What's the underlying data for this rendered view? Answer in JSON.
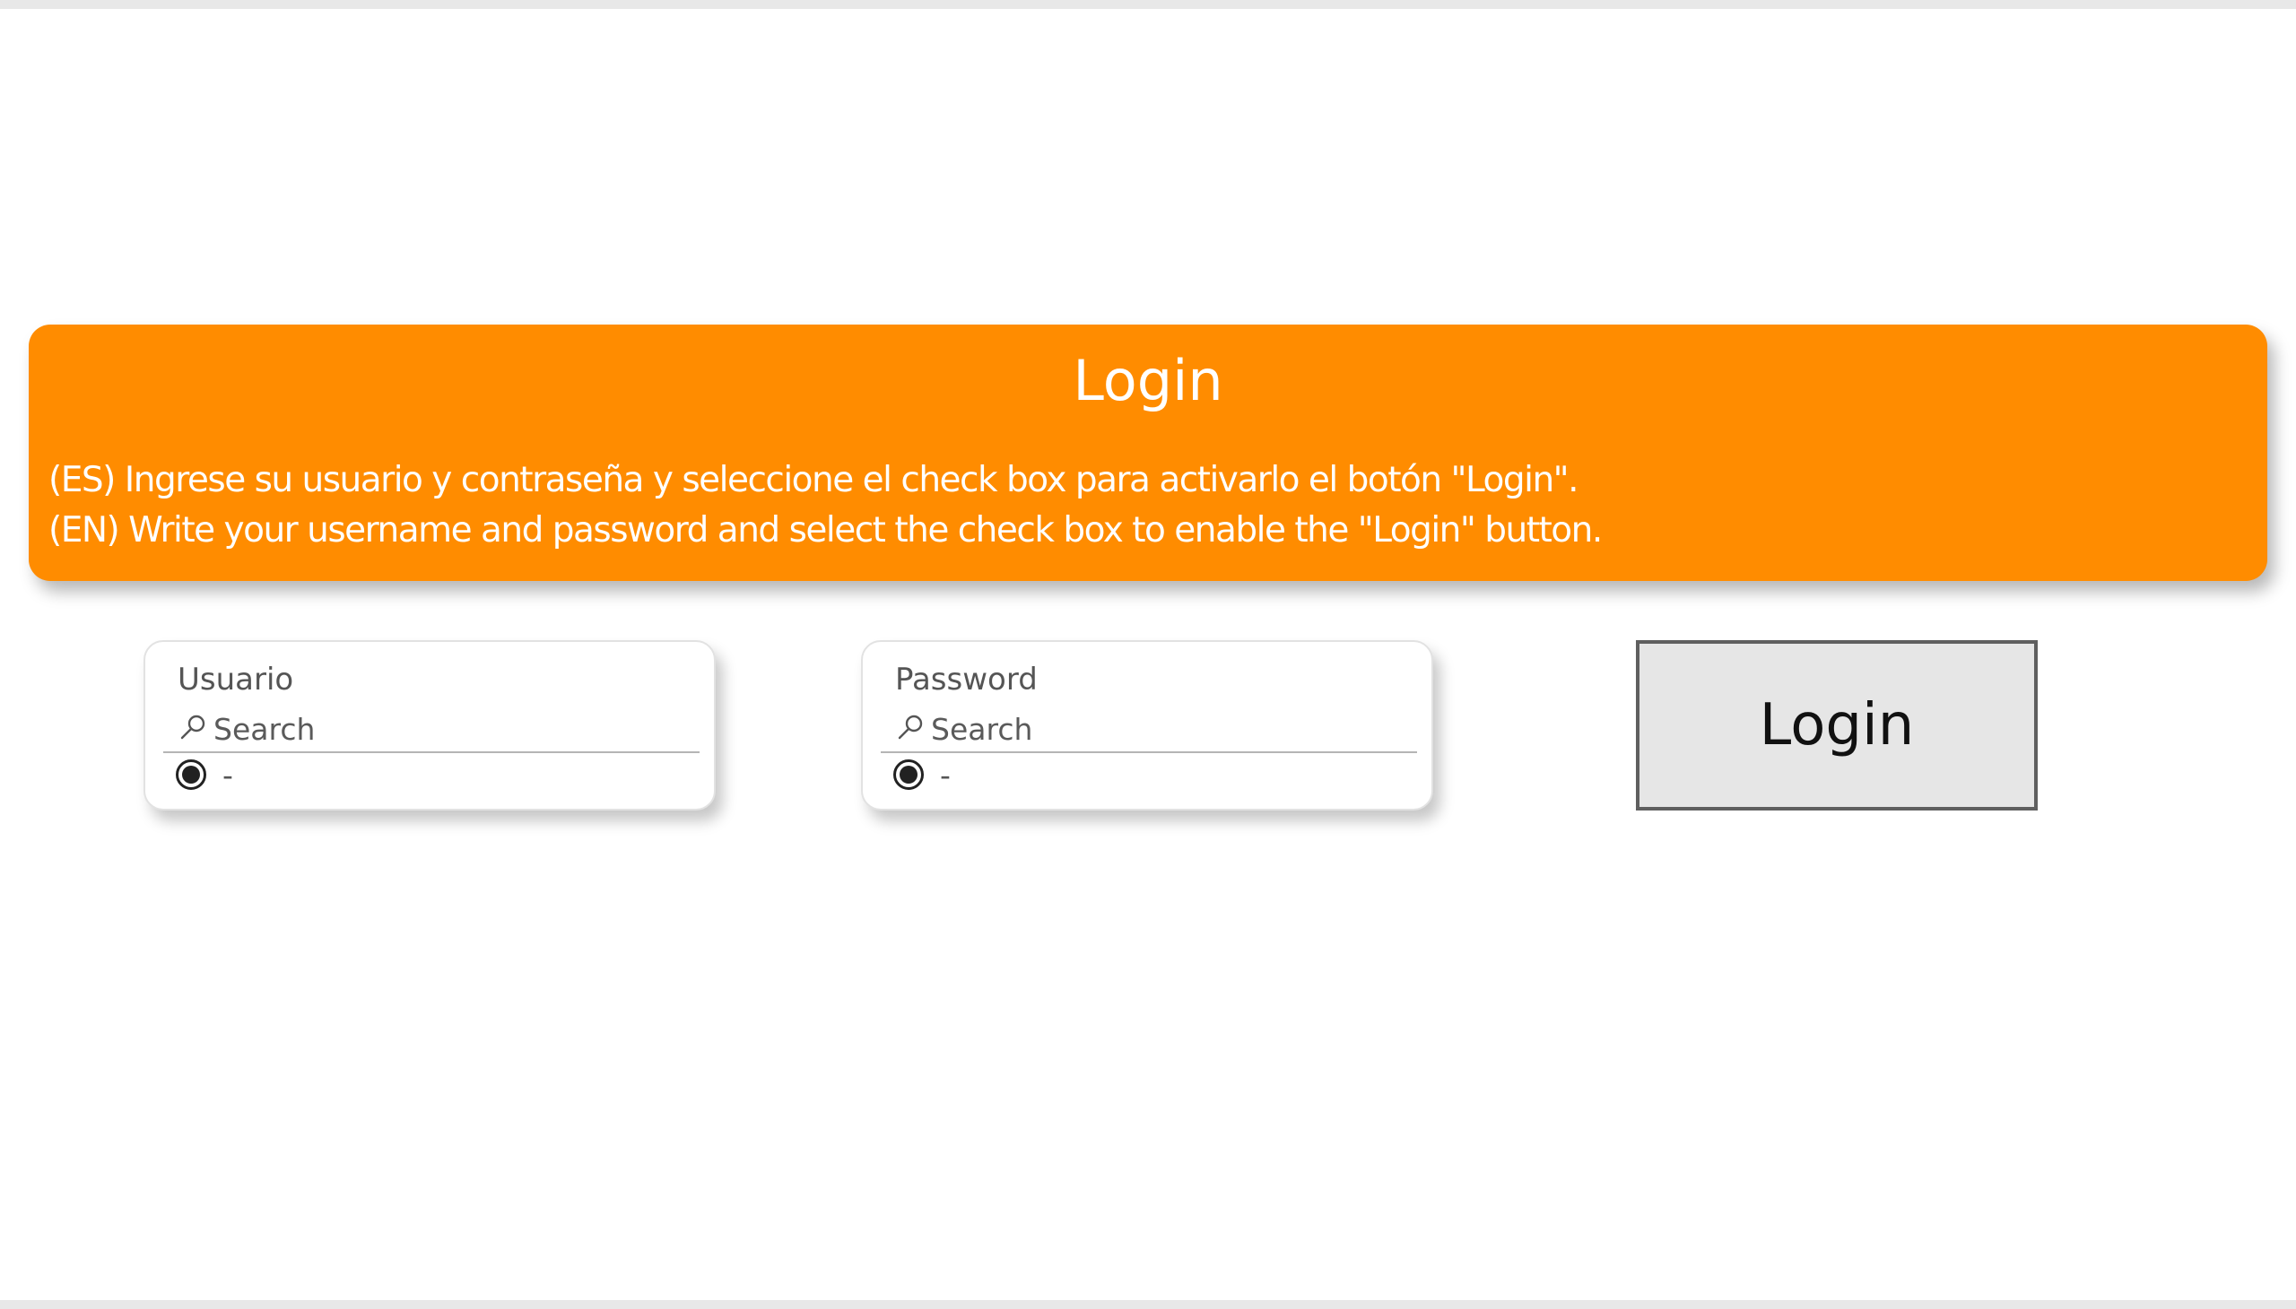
{
  "banner": {
    "title": "Login",
    "line_es": "(ES) Ingrese su usuario y contraseña y seleccione el check box para activarlo el botón \"Login\".",
    "line_en": "(EN) Write your username and password and select the check box to enable the \"Login\" button.",
    "color": "#ff8c00"
  },
  "user_slicer": {
    "title": "Usuario",
    "search_placeholder": "Search",
    "search_icon": "search-icon",
    "option_label": "-",
    "option_selected": true
  },
  "password_slicer": {
    "title": "Password",
    "search_placeholder": "Search",
    "search_icon": "search-icon",
    "option_label": "-",
    "option_selected": true
  },
  "login_button": {
    "label": "Login"
  }
}
